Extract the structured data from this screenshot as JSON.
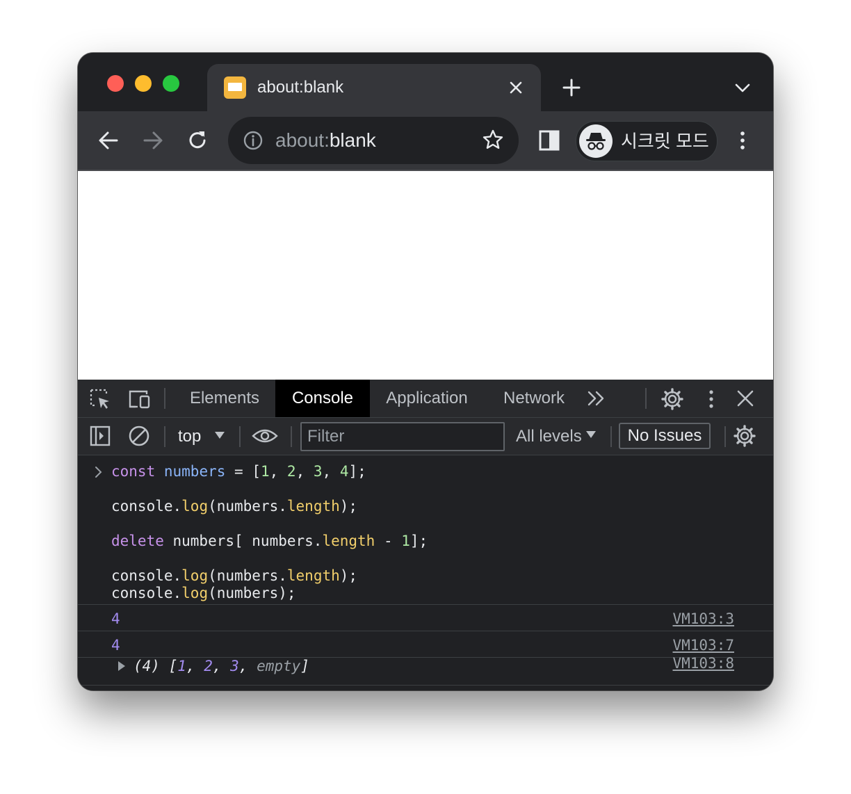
{
  "colors": {
    "traffic_red": "#ff5f57",
    "traffic_yellow": "#febc2e",
    "traffic_green": "#28c840",
    "favicon": "#f3b63f",
    "keyword": "#c792ea",
    "variable": "#8ab4f8",
    "number": "#aee9a4",
    "method": "#f2cf6b",
    "log_number": "#a38cf0"
  },
  "tab": {
    "title": "about:blank",
    "close_icon": "close-icon",
    "new_tab_icon": "plus-icon",
    "menu_icon": "chevron-down-icon"
  },
  "toolbar": {
    "omnibox": {
      "scheme": "about:",
      "host": "blank"
    },
    "incognito_label": "시크릿 모드"
  },
  "devtools": {
    "tabs": [
      {
        "label": "Elements"
      },
      {
        "label": "Console",
        "active": true
      },
      {
        "label": "Application"
      },
      {
        "label": "Network"
      }
    ],
    "overflow_icon": "double-chevron-right-icon",
    "console_toolbar": {
      "context": "top",
      "filter_placeholder": "Filter",
      "levels": "All levels",
      "issues": "No Issues"
    }
  },
  "console": {
    "input": {
      "line1": {
        "kw": "const",
        "var": "numbers",
        "eq": " = [",
        "n1": "1",
        "n2": "2",
        "n3": "3",
        "n4": "4",
        "end": "];"
      },
      "line2": {
        "obj": "console.",
        "fn": "log",
        "open": "(numbers.",
        "prop": "length",
        "close": ");"
      },
      "line3": {
        "kw": "delete",
        "mid": " numbers[ numbers.",
        "prop": "length",
        "minus": " - ",
        "one": "1",
        "end": "];"
      },
      "line4": {
        "obj": "console.",
        "fn": "log",
        "open": "(numbers.",
        "prop": "length",
        "close": ");"
      },
      "line5": {
        "obj": "console.",
        "fn": "log",
        "rest": "(numbers);"
      }
    },
    "outputs": [
      {
        "value": "4",
        "source": "VM103:3"
      },
      {
        "value": "4",
        "source": "VM103:7"
      },
      {
        "source": "VM103:8",
        "array": {
          "count": "(4) ",
          "open": "[",
          "v1": "1",
          "v2": "2",
          "v3": "3",
          "empty": "empty",
          "close": "]"
        }
      }
    ]
  }
}
